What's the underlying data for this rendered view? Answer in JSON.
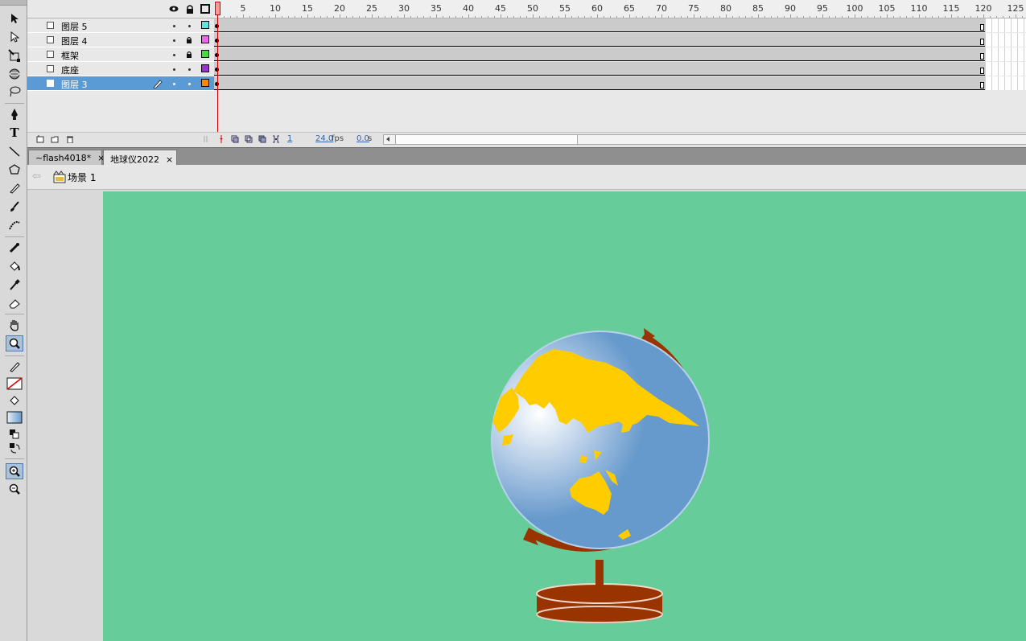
{
  "colors": {
    "stage": "#66cc99",
    "selection": "#5b9bd5",
    "globe_ocean": "#6699cc",
    "globe_land": "#ffcc00",
    "stand": "#993300",
    "playhead": "#cc0000"
  },
  "tools": [
    {
      "name": "selection-tool-icon"
    },
    {
      "name": "subselection-tool-icon"
    },
    {
      "name": "free-transform-tool-icon"
    },
    {
      "name": "3d-rotation-tool-icon"
    },
    {
      "name": "lasso-tool-icon"
    },
    {
      "name": "pen-tool-icon"
    },
    {
      "name": "text-tool-icon",
      "glyph": "T"
    },
    {
      "name": "line-tool-icon"
    },
    {
      "name": "polystar-tool-icon"
    },
    {
      "name": "pencil-tool-icon"
    },
    {
      "name": "brush-tool-icon"
    },
    {
      "name": "deco-tool-icon"
    },
    {
      "name": "bone-tool-icon"
    },
    {
      "name": "paint-bucket-tool-icon"
    },
    {
      "name": "eyedropper-tool-icon"
    },
    {
      "name": "eraser-tool-icon"
    },
    {
      "name": "hand-tool-icon"
    },
    {
      "name": "zoom-tool-icon"
    }
  ],
  "timeline": {
    "layers": [
      {
        "name": "图层 5",
        "locked": false,
        "swatch": "#66e0e0",
        "selected": false
      },
      {
        "name": "图层 4",
        "locked": true,
        "swatch": "#ee66ee",
        "selected": false
      },
      {
        "name": "框架",
        "locked": true,
        "swatch": "#44dd44",
        "selected": false
      },
      {
        "name": "底座",
        "locked": false,
        "swatch": "#9933cc",
        "selected": false
      },
      {
        "name": "图层 3",
        "locked": false,
        "swatch": "#ff8800",
        "selected": true
      }
    ],
    "ruler_labels": [
      "1",
      "5",
      "10",
      "15",
      "20",
      "25",
      "30",
      "35",
      "40",
      "45",
      "50",
      "55",
      "60",
      "65",
      "70",
      "75",
      "80",
      "85",
      "90",
      "95",
      "100",
      "105",
      "110",
      "115",
      "120",
      "125"
    ],
    "current_frame": "1",
    "fps": "24.0",
    "fps_unit": "fps",
    "elapsed": "0.0",
    "elapsed_unit": "s"
  },
  "doc_tabs": [
    {
      "label": "~flash4018*",
      "active": false
    },
    {
      "label": "地球仪2022",
      "active": true
    }
  ],
  "close_glyph": "×",
  "edit_bar": {
    "back_glyph": "⇦",
    "scene_label": "场景 1"
  }
}
